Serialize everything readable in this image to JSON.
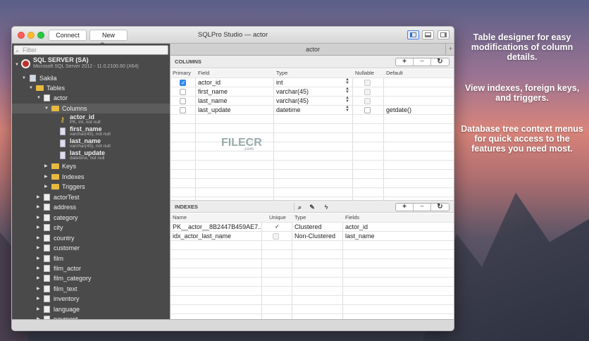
{
  "promo": [
    "Table designer for easy modifications of column details.",
    "View indexes, foreign keys, and triggers.",
    "Database tree context menus for quick access to the features you need most."
  ],
  "window": {
    "title": "SQLPro Studio — actor",
    "connect_label": "Connect",
    "new_query_label": "New Query"
  },
  "sidebar": {
    "filter_placeholder": "Filter",
    "server_name": "SQL SERVER (SA)",
    "server_version": "Microsoft SQL Server 2012 - 11.0.2100.60 (X64)",
    "database": "Sakila",
    "tables_folder": "Tables",
    "actor_table": "actor",
    "columns_folder": "Columns",
    "columns": [
      {
        "name": "actor_id",
        "detail": "PK, int, not null"
      },
      {
        "name": "first_name",
        "detail": "varchar(45), not null"
      },
      {
        "name": "last_name",
        "detail": "varchar(45), not null"
      },
      {
        "name": "last_update",
        "detail": "datetime, not null"
      }
    ],
    "subfolders": [
      "Keys",
      "Indexes",
      "Triggers"
    ],
    "tables": [
      "actorTest",
      "address",
      "category",
      "city",
      "country",
      "customer",
      "film",
      "film_actor",
      "film_category",
      "film_text",
      "inventory",
      "language",
      "payment"
    ]
  },
  "main": {
    "tab_label": "actor",
    "columns_section": "COLUMNS",
    "columns_headers": [
      "Primary",
      "Field",
      "Type",
      "Nullable",
      "Default"
    ],
    "columns_rows": [
      {
        "primary": true,
        "field": "actor_id",
        "type": "int",
        "nullable": false,
        "default": ""
      },
      {
        "primary": false,
        "field": "first_name",
        "type": "varchar(45)",
        "nullable": false,
        "default": ""
      },
      {
        "primary": false,
        "field": "last_name",
        "type": "varchar(45)",
        "nullable": false,
        "default": ""
      },
      {
        "primary": false,
        "field": "last_update",
        "type": "datetime",
        "nullable": false,
        "default": "getdate()"
      }
    ],
    "indexes_section": "INDEXES",
    "indexes_headers": [
      "Name",
      "Unique",
      "Type",
      "Fields"
    ],
    "indexes_rows": [
      {
        "name": "PK__actor__8B2447B459AE7...",
        "unique": true,
        "type": "Clustered",
        "fields": "actor_id"
      },
      {
        "name": "idx_actor_last_name",
        "unique": false,
        "type": "Non-Clustered",
        "fields": "last_name"
      }
    ],
    "add_symbol": "+",
    "remove_symbol": "−",
    "refresh_symbol": "↻"
  },
  "watermark": {
    "text": "FILECR",
    "sub": ".com"
  },
  "colors": {
    "accent": "#2f8df5",
    "sidebar": "#4a4a4a",
    "folder": "#e7b93e"
  }
}
